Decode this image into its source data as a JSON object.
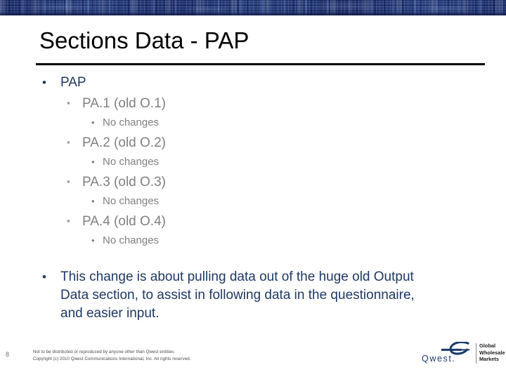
{
  "slide": {
    "title": "Sections Data - PAP",
    "page_number": "8"
  },
  "colors": {
    "banner_blue": "#27407e",
    "level1_navy": "#1f3864",
    "level2_gray": "#808080",
    "rule_black": "#000000",
    "logo_navy": "#1b3a6b"
  },
  "outline": {
    "items": [
      {
        "level": 1,
        "bullet": "round-bullet",
        "text": "PAP"
      },
      {
        "level": 2,
        "bullet": "square-bullet",
        "text": "PA.1 (old O.1)"
      },
      {
        "level": 3,
        "bullet": "small-round-bullet",
        "text": "No changes"
      },
      {
        "level": 2,
        "bullet": "square-bullet",
        "text": "PA.2 (old O.2)"
      },
      {
        "level": 3,
        "bullet": "small-round-bullet",
        "text": "No changes"
      },
      {
        "level": 2,
        "bullet": "square-bullet",
        "text": "PA.3 (old O.3)"
      },
      {
        "level": 3,
        "bullet": "small-round-bullet",
        "text": "No changes"
      },
      {
        "level": 2,
        "bullet": "square-bullet",
        "text": "PA.4 (old O.4)"
      },
      {
        "level": 3,
        "bullet": "small-round-bullet",
        "text": "No changes"
      }
    ],
    "markers": {
      "round": "•",
      "square": "▪",
      "small_round": "•"
    }
  },
  "closing": {
    "bullet": "round-bullet",
    "text": "This change is about pulling data out of the huge old Output Data section, to assist in following data in the questionnaire, and easier input."
  },
  "footer": {
    "legal_line_1": "Not to be distributed or reproduced by anyone other than Qwest entities.",
    "legal_line_2": "Copyright (c) 2010 Qwest Communications International, Inc.  All rights reserved."
  },
  "logo": {
    "wordmark": "Qwest.",
    "tagline_line_1": "Global",
    "tagline_line_2": "Wholesale",
    "tagline_line_3": "Markets"
  }
}
